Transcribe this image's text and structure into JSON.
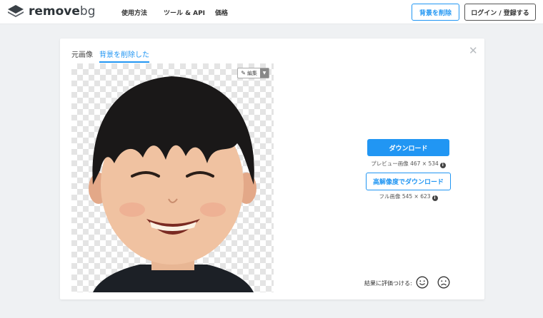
{
  "header": {
    "logo_text_main": "remove",
    "logo_text_bg": "bg",
    "nav": [
      "使用方法",
      "ツール & API",
      "価格"
    ],
    "remove_bg_button": "背景を削除",
    "login_button": "ログイン / 登録する"
  },
  "card": {
    "tab_original": "元画像",
    "tab_removed": "背景を削除した",
    "close": "✕",
    "edit_label": "編集",
    "download_button": "ダウンロード",
    "preview_meta": "プレビュー画像 467 × 534",
    "hd_download_button": "高解像度でダウンロード",
    "full_meta": "フル画像 545 × 623",
    "rate_label": "結果に評価つける:",
    "info_glyph": "i"
  },
  "colors": {
    "accent": "#2196f3",
    "background": "#eff1f3"
  }
}
